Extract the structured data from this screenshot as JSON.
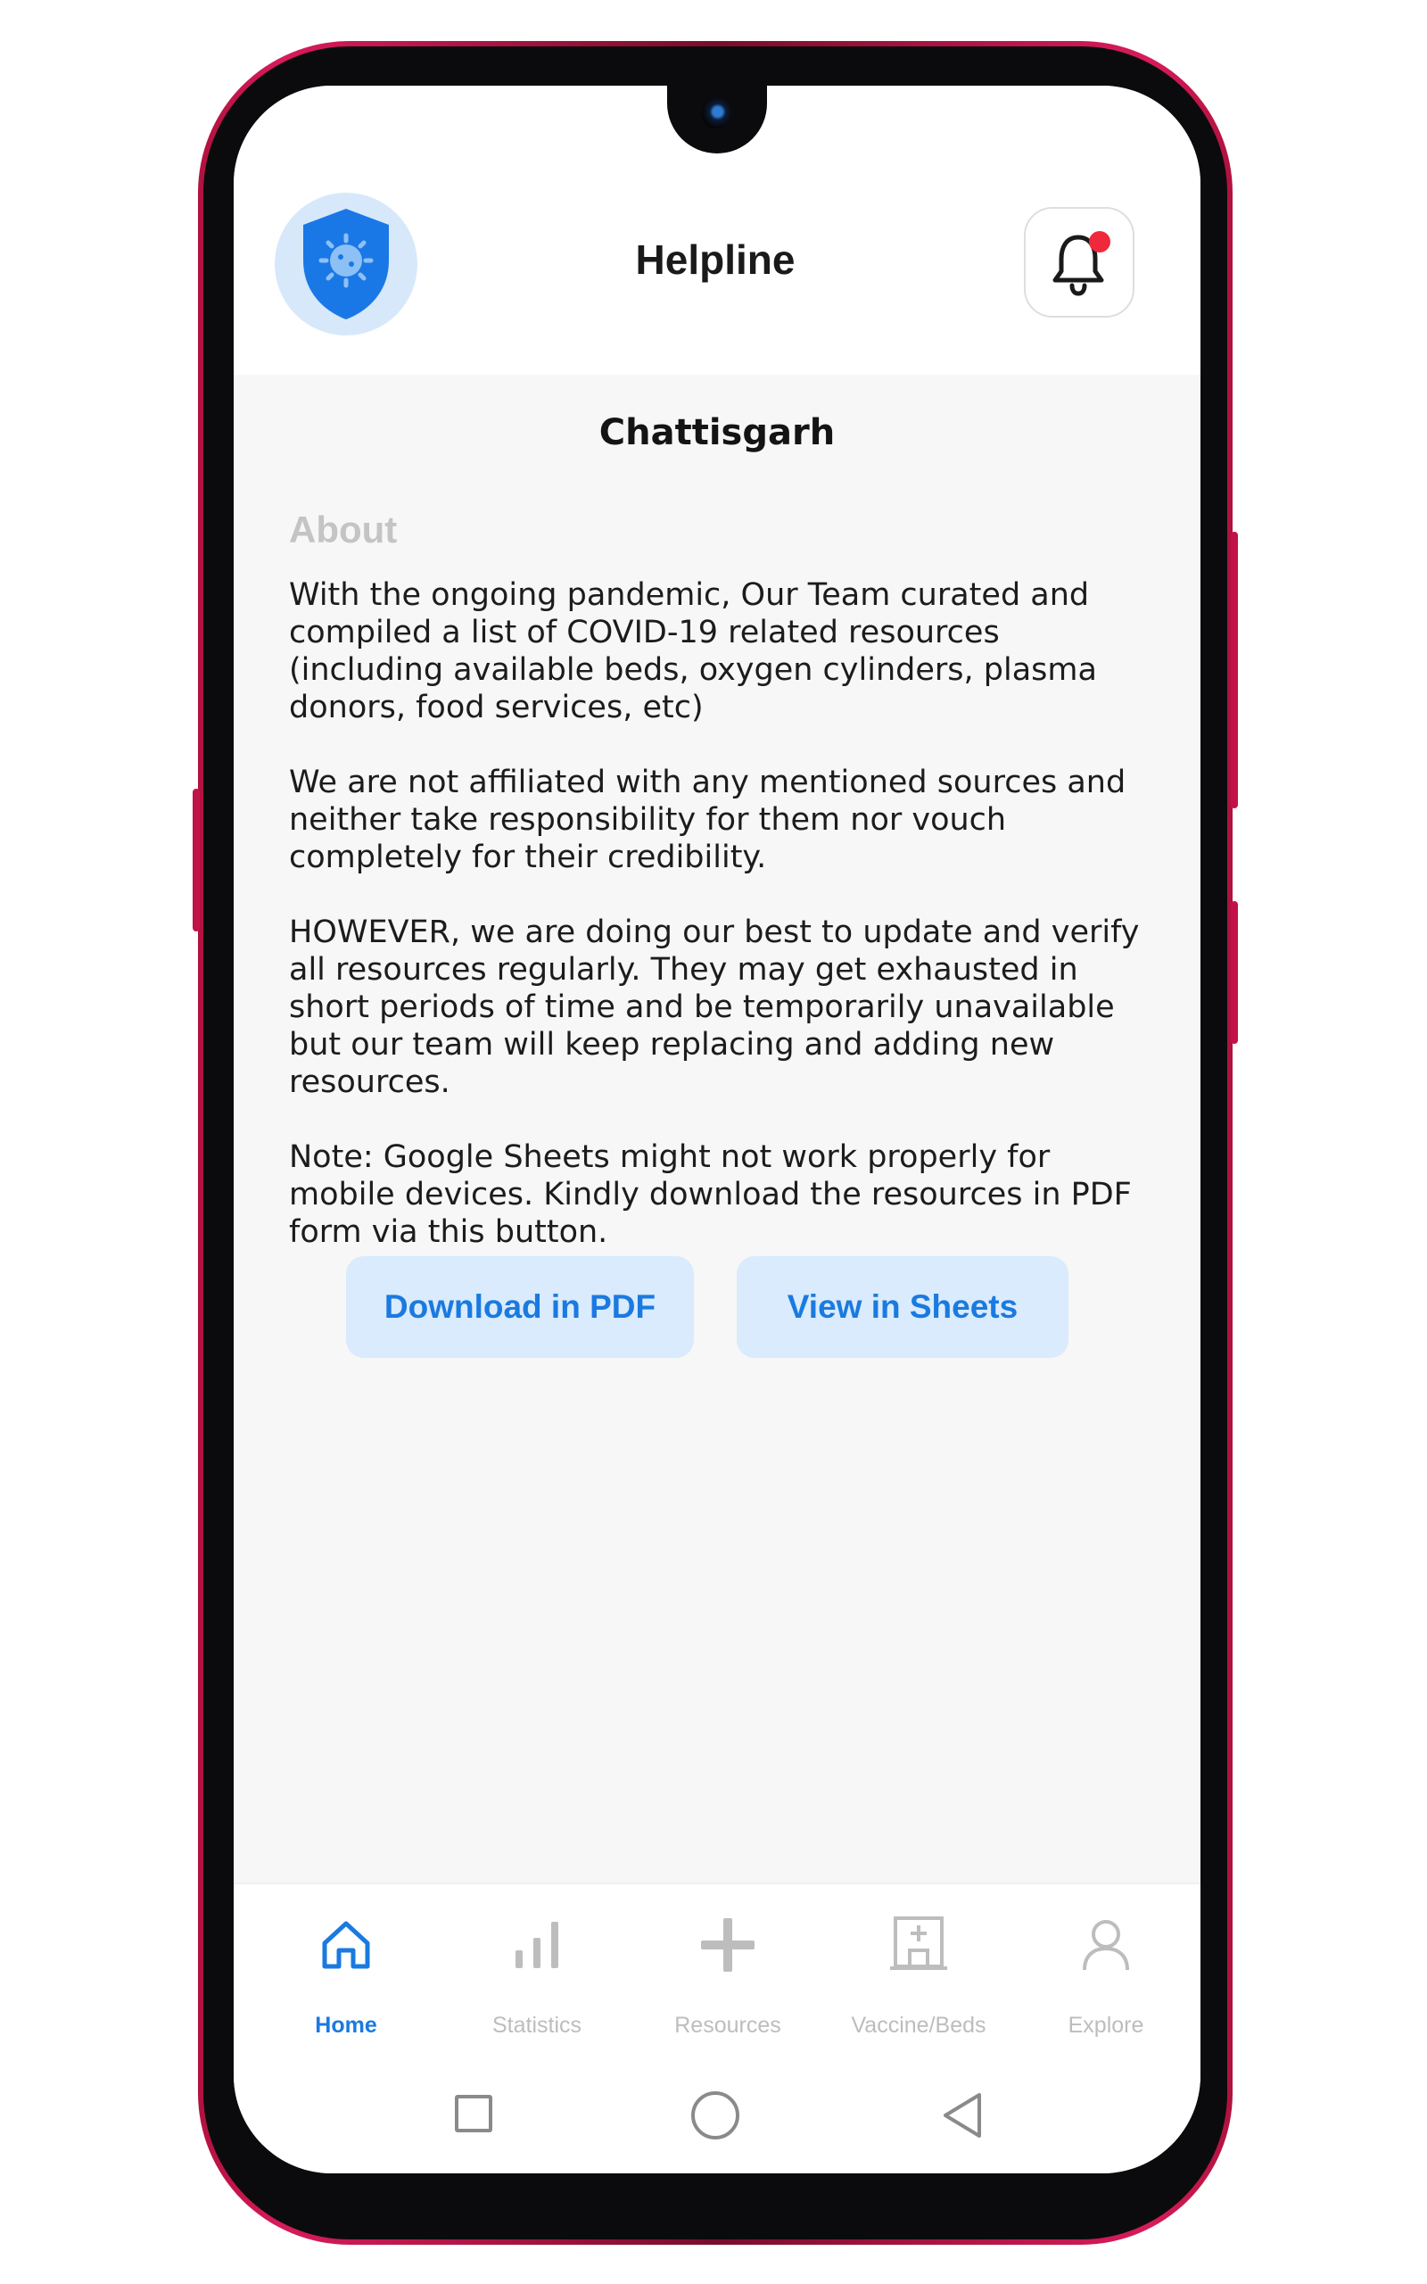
{
  "header": {
    "title": "Helpline",
    "logo_icon": "shield-virus-icon",
    "notification_icon": "bell-icon",
    "notification_dot_color": "#f0283c"
  },
  "main": {
    "state_name": "Chattisgarh",
    "about_label": "About",
    "paragraphs": [
      "With the ongoing pandemic, Our Team curated and compiled a list of COVID-19 related resources (including available beds, oxygen cylinders, plasma donors, food services, etc)",
      "We are not affiliated with any mentioned sources and neither take responsibility for them nor vouch completely for their credibility.",
      "HOWEVER, we are doing our best to update and verify all resources regularly. They may get exhausted in short periods of time and be temporarily unavailable but our team will keep replacing and adding new resources.",
      "Note: Google Sheets might not work properly for mobile devices. Kindly download the resources in PDF form via this button."
    ],
    "download_pdf_label": "Download in PDF",
    "view_sheets_label": "View in Sheets"
  },
  "tabs": [
    {
      "label": "Home",
      "icon": "home-icon",
      "active": true
    },
    {
      "label": "Statistics",
      "icon": "bar-chart-icon",
      "active": false
    },
    {
      "label": "Resources",
      "icon": "plus-icon",
      "active": false
    },
    {
      "label": "Vaccine/Beds",
      "icon": "hospital-icon",
      "active": false
    },
    {
      "label": "Explore",
      "icon": "user-icon",
      "active": false
    }
  ],
  "android_nav": {
    "recents_icon": "square-icon",
    "home_icon": "circle-icon",
    "back_icon": "triangle-back-icon"
  },
  "colors": {
    "accent": "#1a7ae0",
    "button_bg": "#d9ebfc",
    "content_bg": "#f7f7f7",
    "inactive": "#bdbdbd",
    "phone_frame": "#c2124a"
  }
}
